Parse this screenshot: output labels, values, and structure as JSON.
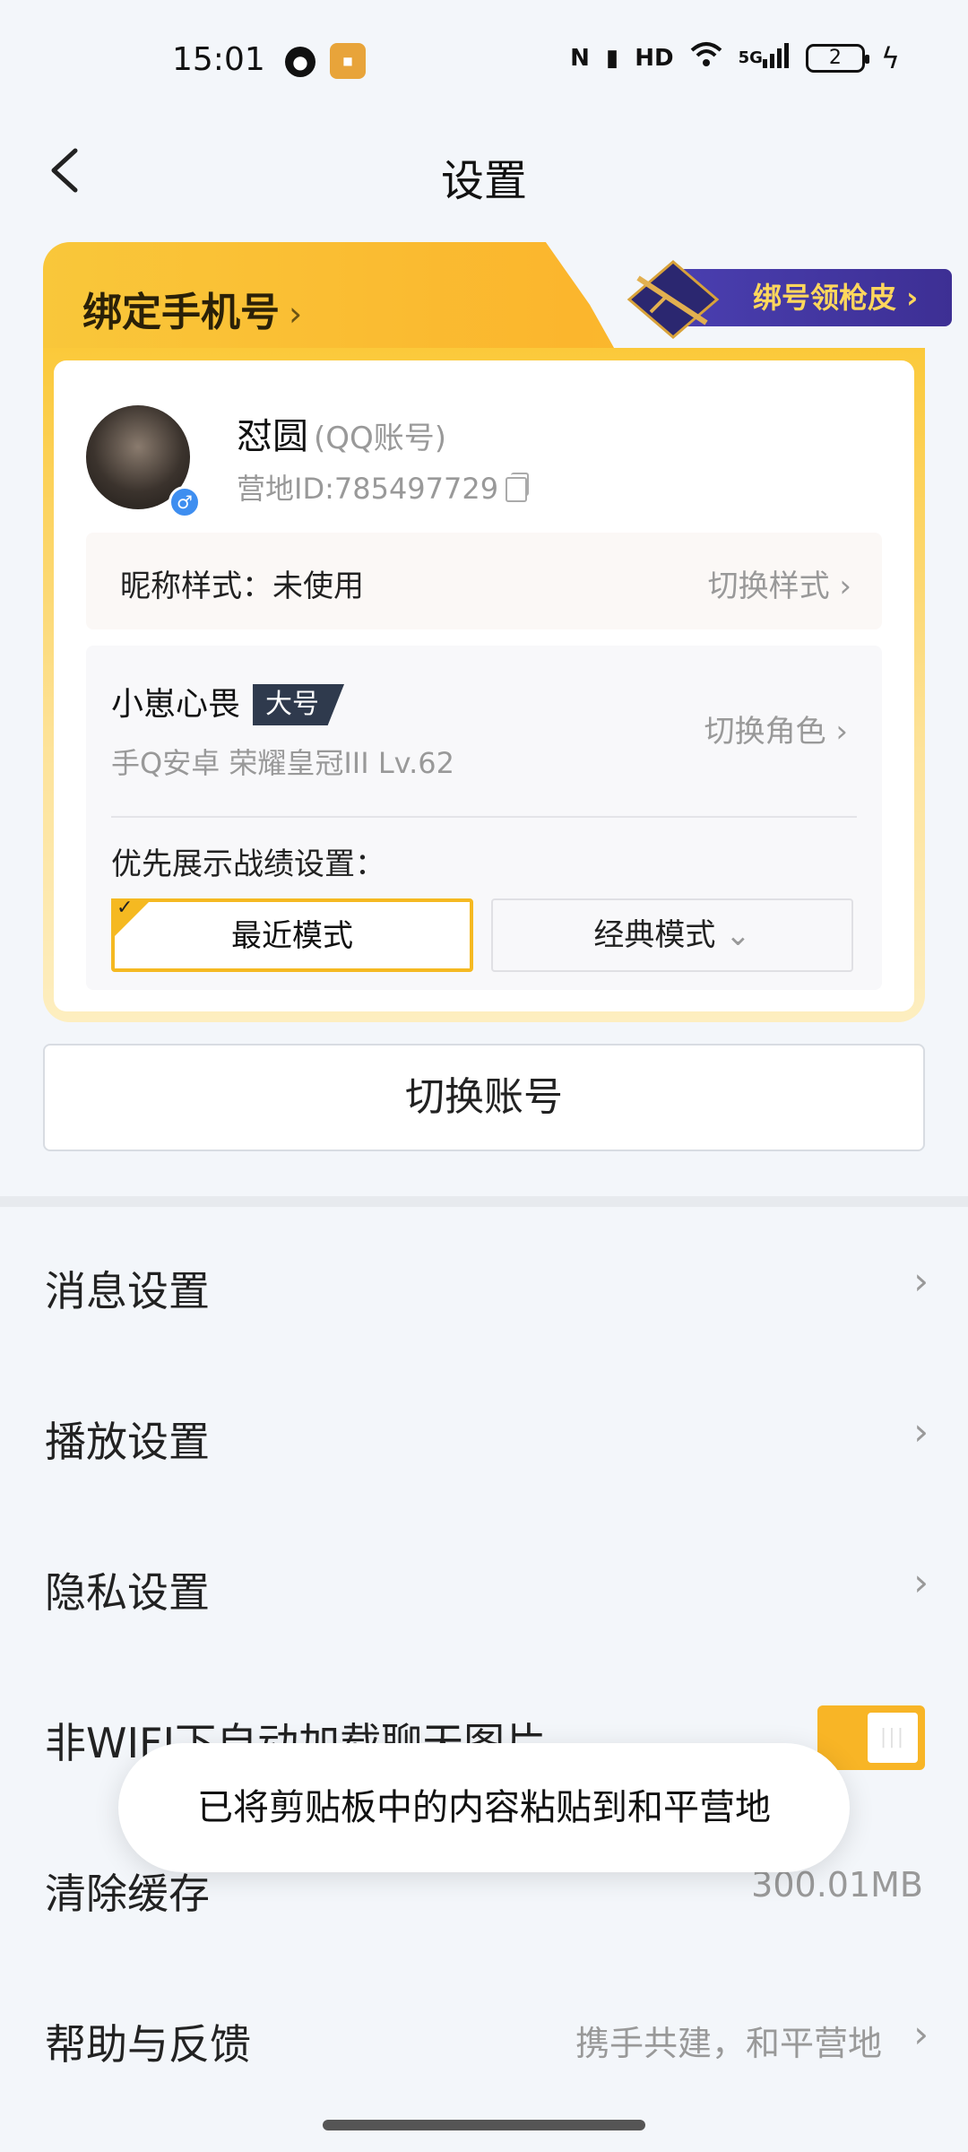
{
  "status_bar": {
    "time": "15:01",
    "icons": [
      "nfc-icon",
      "vibrate-icon",
      "hd-icon",
      "wifi-icon",
      "signal-5g-icon"
    ],
    "hd_label": "HD",
    "net_label": "5G",
    "battery_level": "2"
  },
  "header": {
    "title": "设置",
    "back_icon": "chevron-left-icon"
  },
  "account_card": {
    "bind_phone_label": "绑定手机号",
    "bind_reward_label": "绑号领枪皮",
    "user_name": "怼圆",
    "account_type": "(QQ账号)",
    "user_id": "营地ID:785497729",
    "nickname_style_label": "昵称样式：未使用",
    "nickname_switch_label": "切换样式",
    "role_name": "小崽心畏",
    "role_tag": "大号",
    "role_info": "手Q安卓  荣耀皇冠III  Lv.62",
    "role_switch_label": "切换角色",
    "priority_label": "优先展示战绩设置：",
    "mode_recent_label": "最近模式",
    "mode_classic_label": "经典模式",
    "selected_mode": "最近模式"
  },
  "switch_account_label": "切换账号",
  "settings": {
    "message": "消息设置",
    "playback": "播放设置",
    "privacy": "隐私设置",
    "auto_load_images": "非WIFI下自动加载聊天图片",
    "auto_load_images_on": true,
    "clear_cache": "清除缓存",
    "cache_size": "300.01MB",
    "help_feedback": "帮助与反馈",
    "help_feedback_value": "携手共建，和平营地"
  },
  "toast": {
    "text": "已将剪贴板中的内容粘贴到和平营地"
  },
  "colors": {
    "accent": "#f8b526",
    "card_gold": "#fbc93a",
    "reward_purple": "#4a3fb0"
  }
}
